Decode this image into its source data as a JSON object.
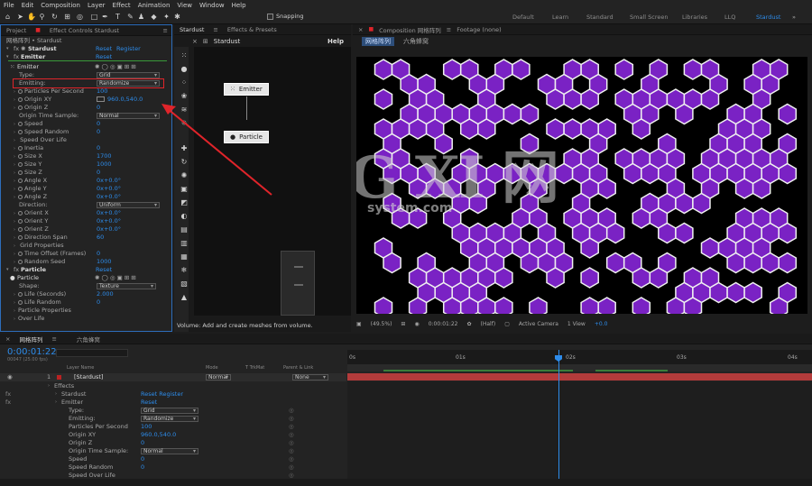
{
  "menu": [
    "File",
    "Edit",
    "Composition",
    "Layer",
    "Effect",
    "Animation",
    "View",
    "Window",
    "Help"
  ],
  "toolbar": {
    "snapping_label": "Snapping"
  },
  "workspaces": {
    "items": [
      "Default",
      "Learn",
      "Standard",
      "Small Screen",
      "Libraries",
      "LLQ",
      "Stardust"
    ],
    "active": "Stardust"
  },
  "left_panel": {
    "tabs": [
      "Project",
      "Effect Controls",
      "Stardust"
    ],
    "breadcrumb": "网格阵列 • Stardust",
    "effect_name": "Stardust",
    "reset": "Reset",
    "register": "Register",
    "emitter_group": "Emitter",
    "emitter_reset": "Reset",
    "emitter_sub": "Emitter",
    "props": [
      {
        "label": "Type:",
        "value": "Grid",
        "kind": "dropdown"
      },
      {
        "label": "Emitting:",
        "value": "Randomize",
        "kind": "dropdown"
      },
      {
        "label": "Particles Per Second",
        "value": "100"
      },
      {
        "label": "Origin XY",
        "value": "960.0,540.0"
      },
      {
        "label": "Origin Z",
        "value": "0"
      },
      {
        "label": "Origin Time Sample:",
        "value": "Normal",
        "kind": "dropdown"
      },
      {
        "label": "Speed",
        "value": "0"
      },
      {
        "label": "Speed Random",
        "value": "0"
      },
      {
        "label": "Speed Over Life",
        "value": ""
      },
      {
        "label": "Inertia",
        "value": "0"
      },
      {
        "label": "Size X",
        "value": "1700"
      },
      {
        "label": "Size Y",
        "value": "1000"
      },
      {
        "label": "Size Z",
        "value": "0"
      },
      {
        "label": "Angle X",
        "value": "0x+0.0°"
      },
      {
        "label": "Angle Y",
        "value": "0x+0.0°"
      },
      {
        "label": "Angle Z",
        "value": "0x+0.0°"
      },
      {
        "label": "Direction:",
        "value": "Uniform",
        "kind": "dropdown"
      },
      {
        "label": "Orient X",
        "value": "0x+0.0°"
      },
      {
        "label": "Orient Y",
        "value": "0x+0.0°"
      },
      {
        "label": "Orient Z",
        "value": "0x+0.0°"
      },
      {
        "label": "Direction Span",
        "value": "60"
      },
      {
        "label": "Grid Properties",
        "value": ""
      },
      {
        "label": "Time Offset (Frames)",
        "value": "0"
      },
      {
        "label": "Random Seed",
        "value": "1000"
      }
    ],
    "particle_group": "Particle",
    "particle_reset": "Reset",
    "particle_sub": "Particle",
    "particle_props": [
      {
        "label": "Shape:",
        "value": "Texture",
        "kind": "dropdown"
      },
      {
        "label": "Life (Seconds)",
        "value": "2.000"
      },
      {
        "label": "Life Random",
        "value": "0"
      },
      {
        "label": "Particle Properties",
        "value": ""
      },
      {
        "label": "Over Life",
        "value": ""
      }
    ]
  },
  "stardust_panel": {
    "tabs": [
      "Stardust",
      "Effects & Presets"
    ],
    "title": "Stardust",
    "help": "Help",
    "nodes": [
      "Emitter",
      "Particle"
    ],
    "status": "Volume: Add and create meshes from volume."
  },
  "composition": {
    "tabs": [
      "Composition",
      "网格阵列",
      "Footage (none)"
    ],
    "subtabs": [
      "网格阵列",
      "六角蜂窝"
    ],
    "watermark": "G XI 网",
    "watermark_sub": "system.com",
    "footer": {
      "zoom": "(49.5%)",
      "time": "0:00:01:22",
      "res": "(Half)",
      "camera": "Active Camera",
      "view": "1 View",
      "offset": "+0.0"
    }
  },
  "timeline": {
    "tabs": [
      "网格阵列",
      "六角蜂窝"
    ],
    "timecode": "0:00:01:22",
    "timecode_sub": "00047 (25.00 fps)",
    "ruler": [
      "0s",
      "01s",
      "02s",
      "03s",
      "04s"
    ],
    "cols": [
      "Layer Name",
      "Mode",
      "T TrkMat",
      "Parent & Link"
    ],
    "layer": {
      "num": "1",
      "name": "[Stardust]",
      "mode": "Normal",
      "parent": "None"
    },
    "rows": [
      {
        "label": "Effects",
        "value": ""
      },
      {
        "label": "Stardust",
        "value": "Reset   Register"
      },
      {
        "label": "Emitter",
        "value": "Reset"
      },
      {
        "label": "Type:",
        "value": "Grid",
        "kind": "dropdown"
      },
      {
        "label": "Emitting:",
        "value": "Randomize",
        "kind": "dropdown"
      },
      {
        "label": "Particles Per Second",
        "value": "100"
      },
      {
        "label": "Origin XY",
        "value": "960.0,540.0"
      },
      {
        "label": "Origin Z",
        "value": "0"
      },
      {
        "label": "Origin Time Sample:",
        "value": "Normal",
        "kind": "dropdown"
      },
      {
        "label": "Speed",
        "value": "0"
      },
      {
        "label": "Speed Random",
        "value": "0"
      },
      {
        "label": "Speed Over Life",
        "value": ""
      }
    ]
  },
  "colors": {
    "accent": "#2d8ceb",
    "hex_fill": "#7a22c4",
    "highlight": "#e0242a"
  }
}
